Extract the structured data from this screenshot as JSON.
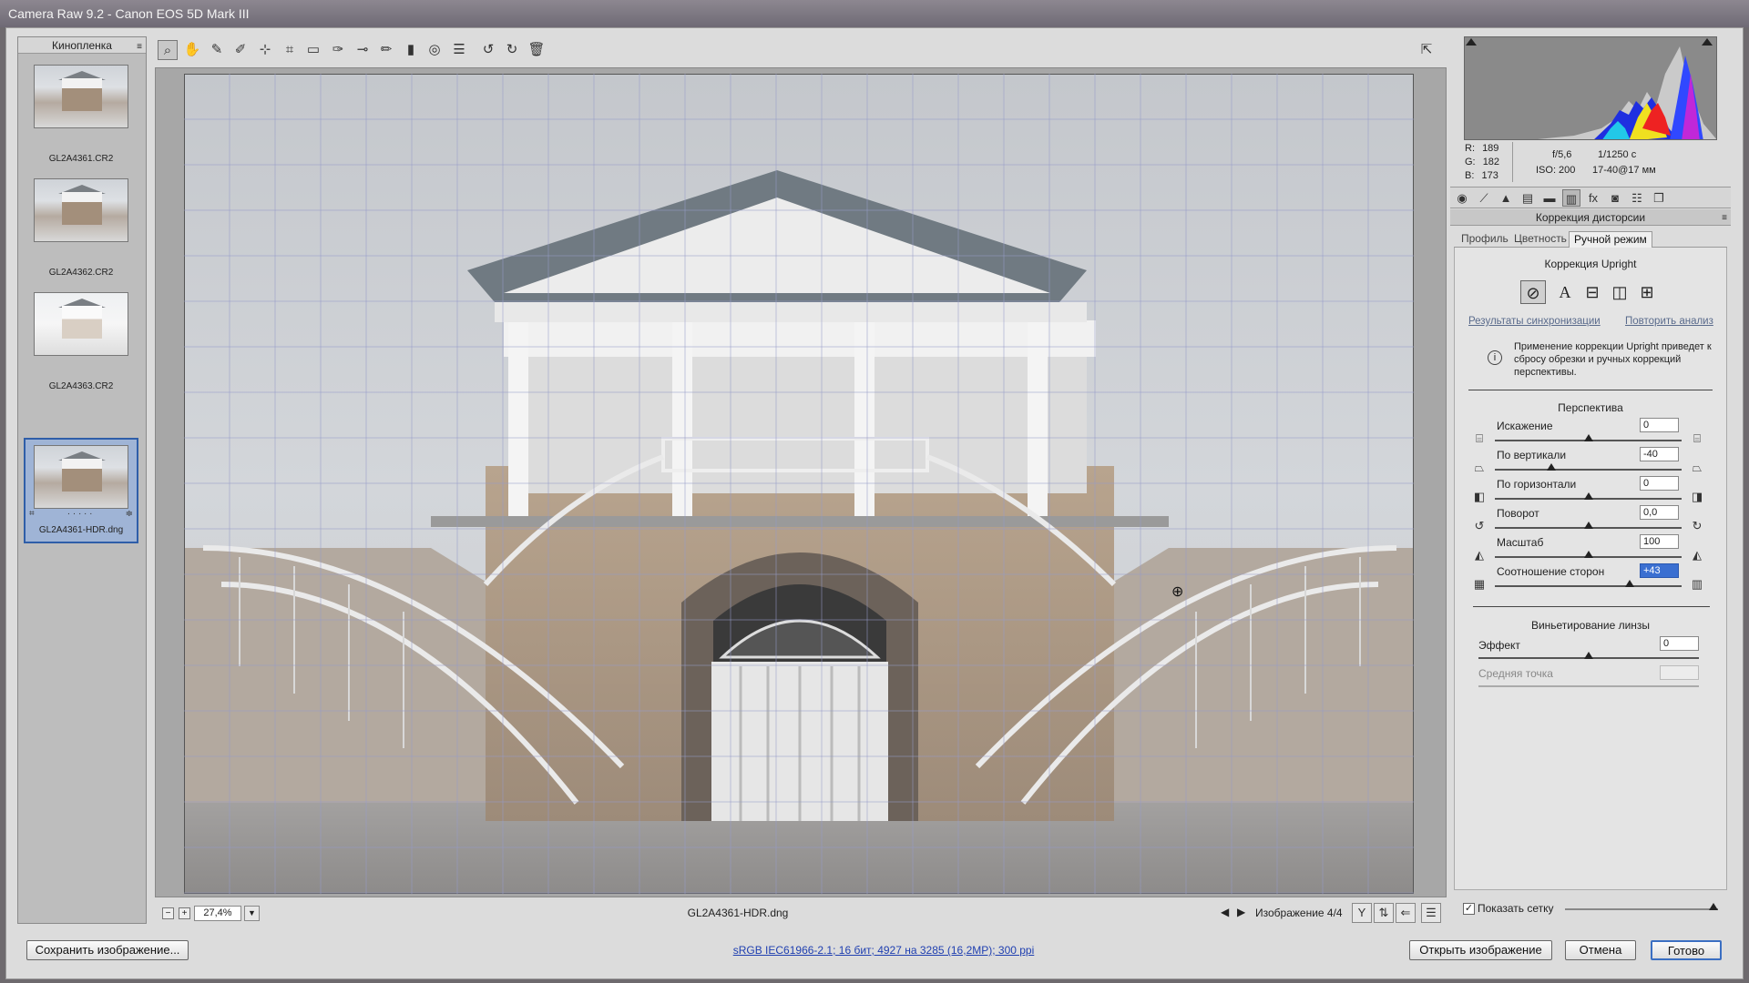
{
  "window": {
    "title": "Camera Raw 9.2  -  Canon EOS 5D Mark III"
  },
  "filmstrip": {
    "header": "Кинопленка",
    "menu_icon": "menu-icon",
    "items": [
      {
        "name": "GL2A4361.CR2"
      },
      {
        "name": "GL2A4362.CR2"
      },
      {
        "name": "GL2A4363.CR2"
      },
      {
        "name": "GL2A4361-HDR.dng",
        "selected": true
      }
    ]
  },
  "toolbar": {
    "tools": [
      "zoom-tool-icon",
      "hand-tool-icon",
      "white-balance-icon",
      "color-sampler-icon",
      "targeted-adjustment-icon",
      "crop-icon",
      "straighten-icon",
      "spot-removal-icon",
      "red-eye-icon",
      "adjustment-brush-icon",
      "graduated-filter-icon",
      "radial-filter-icon",
      "presets-icon",
      "rotate-left-icon",
      "rotate-right-icon",
      "trash-icon"
    ],
    "fullscreen_icon": "fullscreen-icon"
  },
  "preview": {
    "zoom": "27,4%",
    "filename": "GL2A4361-HDR.dng",
    "image_counter": "Изображение 4/4",
    "grid_visible": true
  },
  "histogram": {
    "rgb": {
      "r_label": "R:",
      "r": "189",
      "g_label": "G:",
      "g": "182",
      "b_label": "B:",
      "b": "173"
    },
    "aperture": "f/5,6",
    "shutter": "1/1250 с",
    "iso": "ISO: 200",
    "lens": "17-40@17 мм"
  },
  "panel": {
    "title": "Коррекция дисторсии",
    "tabs": [
      "Профиль",
      "Цветность",
      "Ручной режим"
    ],
    "active_tab": "Ручной режим",
    "upright": {
      "title": "Коррекция Upright",
      "buttons": [
        "off-icon",
        "auto-icon",
        "level-icon",
        "vertical-icon",
        "full-icon"
      ],
      "auto_label": "A",
      "sync_link": "Результаты синхронизации",
      "reanalyze_link": "Повторить анализ",
      "notice": "Применение коррекции Upright приведет к сбросу обрезки и ручных коррекций перспективы."
    },
    "perspective": {
      "title": "Перспектива",
      "sliders": [
        {
          "label": "Искажение",
          "value": "0",
          "pos": 0.5
        },
        {
          "label": "По вертикали",
          "value": "-40",
          "pos": 0.3
        },
        {
          "label": "По горизонтали",
          "value": "0",
          "pos": 0.5
        },
        {
          "label": "Поворот",
          "value": "0,0",
          "pos": 0.5
        },
        {
          "label": "Масштаб",
          "value": "100",
          "pos": 0.5
        },
        {
          "label": "Соотношение сторон",
          "value": "+43",
          "pos": 0.72,
          "selected": true
        }
      ]
    },
    "vignette": {
      "title": "Виньетирование линзы",
      "amount_label": "Эффект",
      "amount_value": "0",
      "midpoint_label": "Средняя точка",
      "midpoint_value": ""
    },
    "show_grid_label": "Показать сетку",
    "show_grid_checked": true
  },
  "bottom": {
    "save_label": "Сохранить изображение...",
    "workflow_link": "sRGB IEC61966-2.1; 16 бит; 4927 на 3285 (16,2MP); 300 ppi",
    "open_label": "Открыть изображение",
    "cancel_label": "Отмена",
    "done_label": "Готово"
  },
  "colors": {
    "accent": "#3b6fc2",
    "link": "#1f3fb0",
    "selection": "#9fb4d6"
  }
}
